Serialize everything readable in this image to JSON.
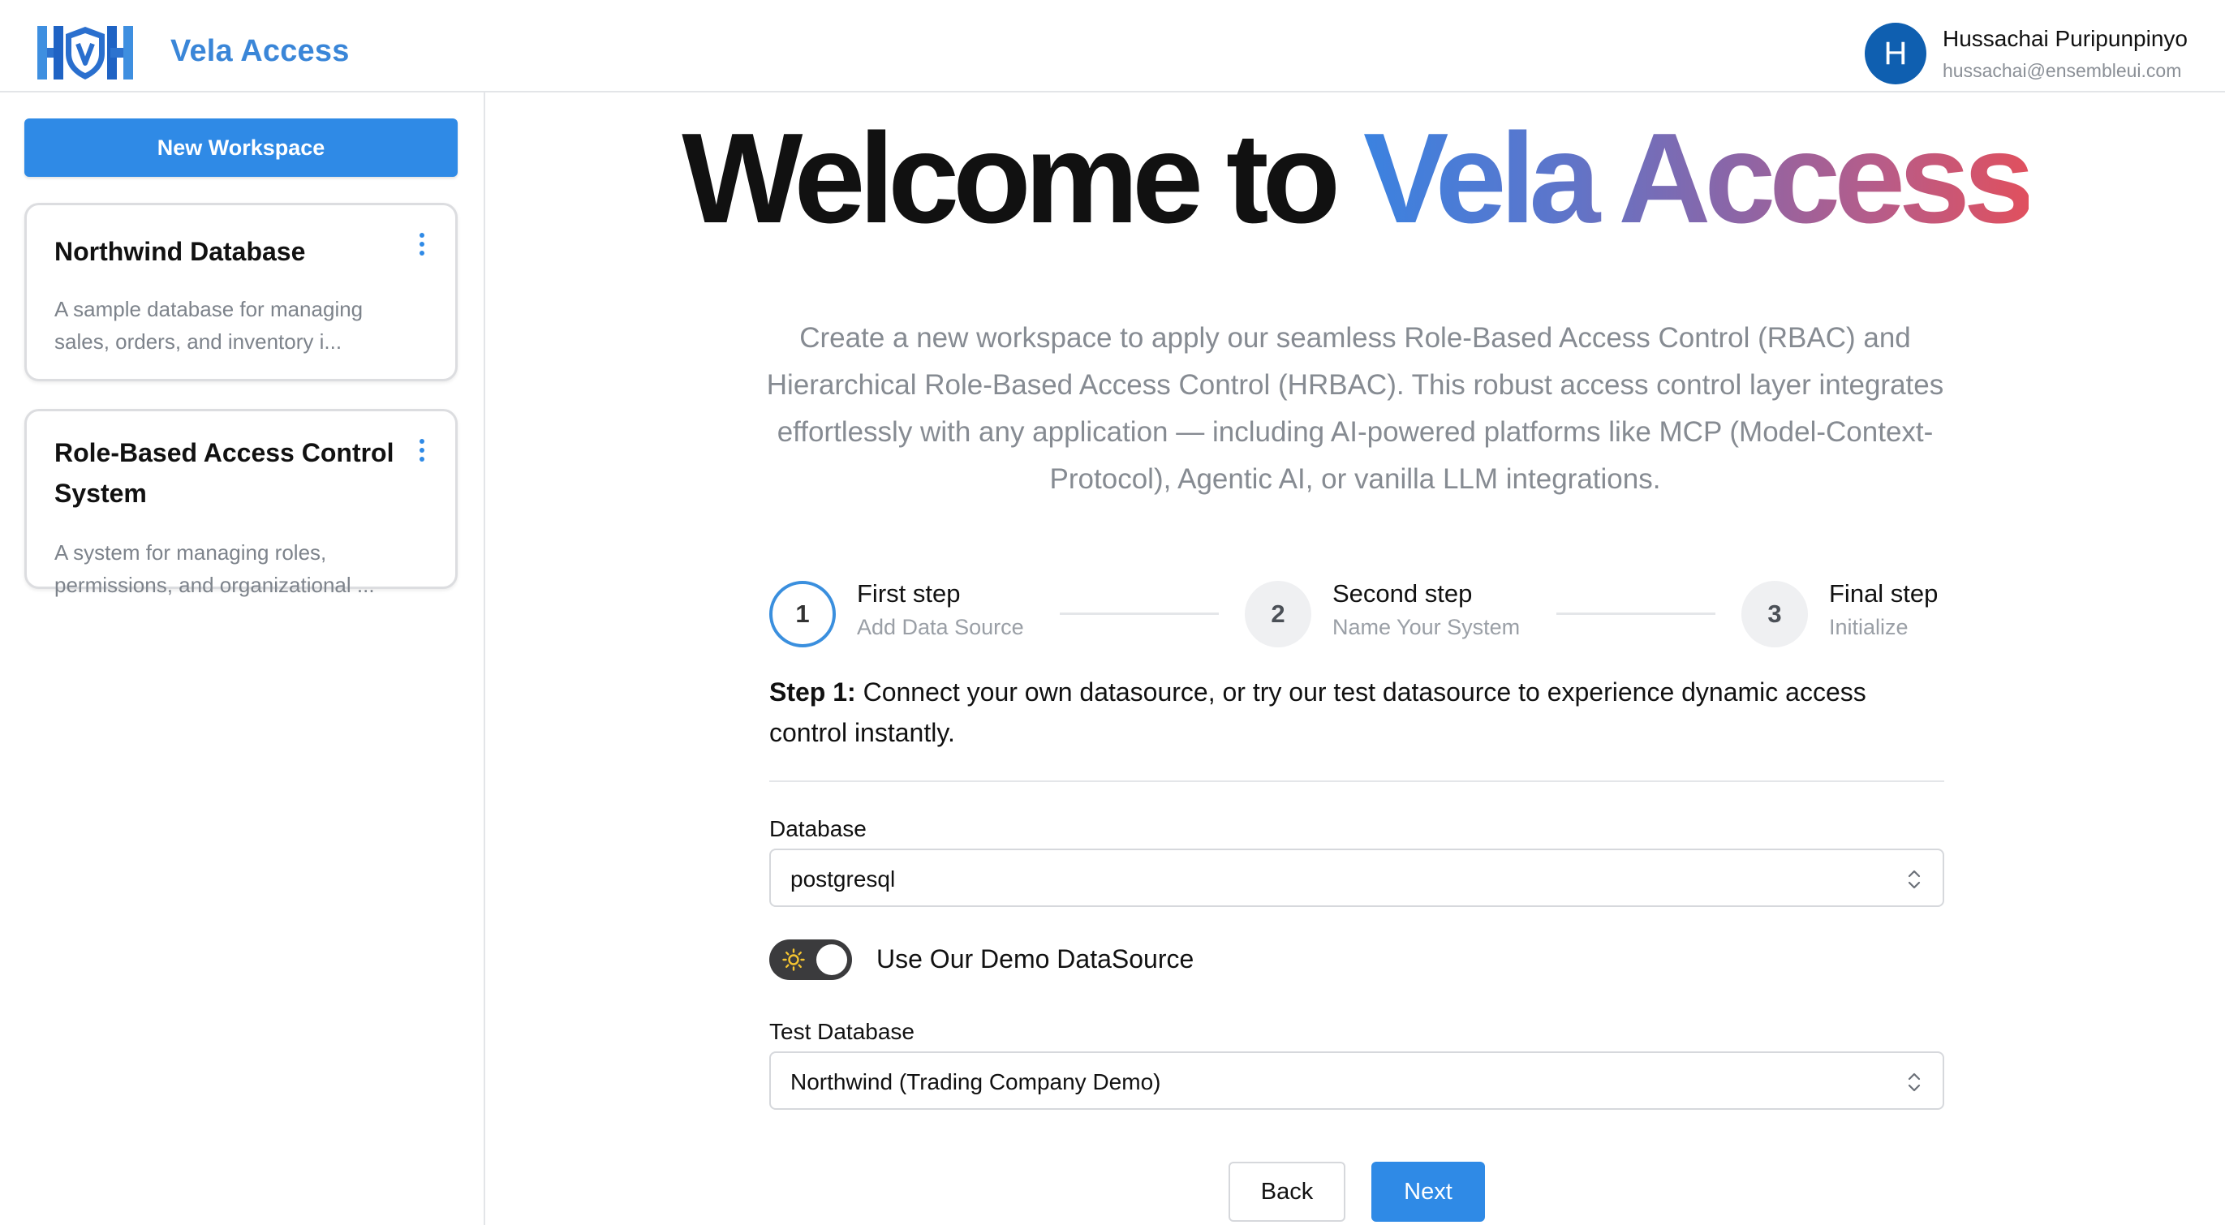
{
  "header": {
    "app_name": "Vela Access",
    "user": {
      "initial": "H",
      "name": "Hussachai Puripunpinyo",
      "email": "hussachai@ensembleui.com"
    }
  },
  "sidebar": {
    "new_workspace_label": "New Workspace",
    "workspaces": [
      {
        "title": "Northwind Database",
        "description": "A sample database for managing sales, orders, and inventory i..."
      },
      {
        "title": "Role-Based Access Control System",
        "description": "A system for managing roles, permissions, and organizational ..."
      }
    ]
  },
  "main": {
    "welcome_prefix": "Welcome to ",
    "welcome_highlight": "Vela Access",
    "intro": "Create a new workspace to apply our seamless Role-Based Access Control (RBAC) and Hierarchical Role-Based Access Control (HRBAC). This robust access control layer integrates effortlessly with any application — including AI-powered platforms like MCP (Model-Context-Protocol), Agentic AI, or vanilla LLM integrations.",
    "steps": [
      {
        "number": "1",
        "title": "First step",
        "subtitle": "Add Data Source",
        "active": true
      },
      {
        "number": "2",
        "title": "Second step",
        "subtitle": "Name Your System",
        "active": false
      },
      {
        "number": "3",
        "title": "Final step",
        "subtitle": "Initialize",
        "active": false
      }
    ],
    "step_heading": "Step 1:",
    "step_text": " Connect your own datasource, or try our test datasource to experience dynamic access control instantly.",
    "database": {
      "label": "Database",
      "value": "postgresql"
    },
    "demo_toggle": {
      "label": "Use Our Demo DataSource",
      "on": true
    },
    "test_database": {
      "label": "Test Database",
      "value": "Northwind (Trading Company Demo)"
    },
    "buttons": {
      "back": "Back",
      "next": "Next"
    }
  },
  "colors": {
    "accent": "#2f8ae6",
    "brand_text": "#3a86d8",
    "avatar": "#0f5fb0",
    "gradient": [
      "#3b82e0",
      "#8a66a8",
      "#e0505e"
    ]
  },
  "icons": {
    "logo": "vela-shield-logo",
    "kebab": "kebab-menu-icon",
    "select": "chevron-up-down-icon",
    "toggle": "sun-icon"
  }
}
